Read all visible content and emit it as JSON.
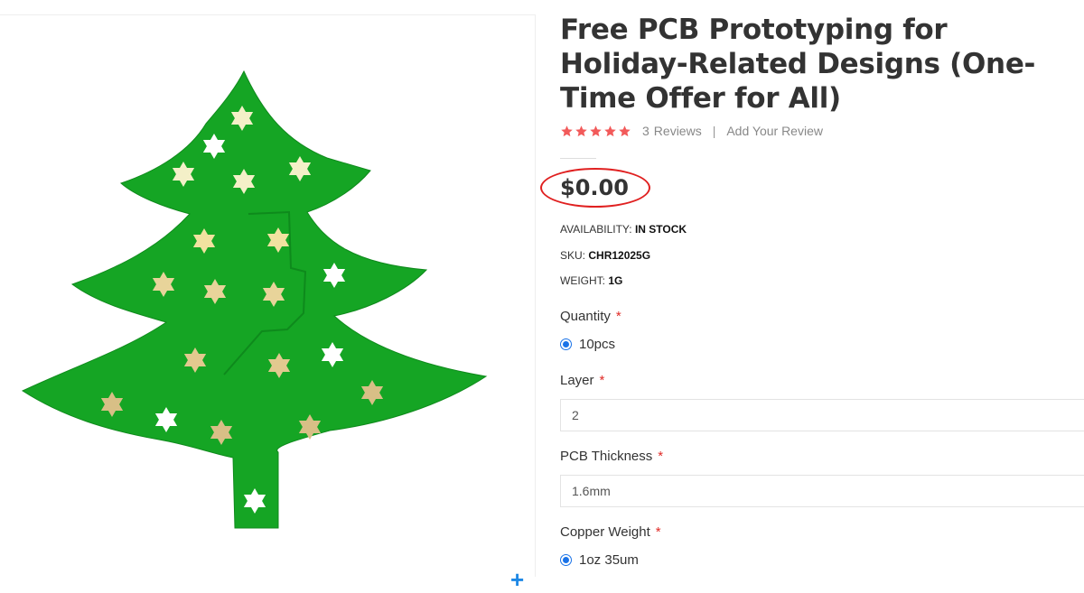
{
  "product": {
    "title": "Free PCB Prototyping for Holiday-Related Designs (One-Time Offer for All)",
    "rating": {
      "stars": 5,
      "max": 5,
      "star_color": "#f25a5a"
    },
    "reviews_count": "3",
    "reviews_label": "Reviews",
    "separator": "|",
    "add_review_label": "Add Your Review",
    "price": "$0.00",
    "price_highlight_color": "#e02020",
    "availability": {
      "label": "AVAILABILITY:",
      "value": "IN STOCK"
    },
    "sku": {
      "label": "SKU:",
      "value": "CHR12025G"
    },
    "weight": {
      "label": "WEIGHT:",
      "value": "1G"
    }
  },
  "options": {
    "required_mark": "*",
    "quantity": {
      "label": "Quantity",
      "selected": "10pcs"
    },
    "layer": {
      "label": "Layer",
      "value": "2"
    },
    "thickness": {
      "label": "PCB Thickness",
      "value": "1.6mm"
    },
    "copper_weight": {
      "label": "Copper Weight",
      "selected": "1oz 35um"
    }
  },
  "gallery": {
    "image_subject": "christmas-tree-pcb",
    "board_color": "#15a524",
    "zoom_icon": "plus-icon",
    "zoom_symbol": "+"
  }
}
